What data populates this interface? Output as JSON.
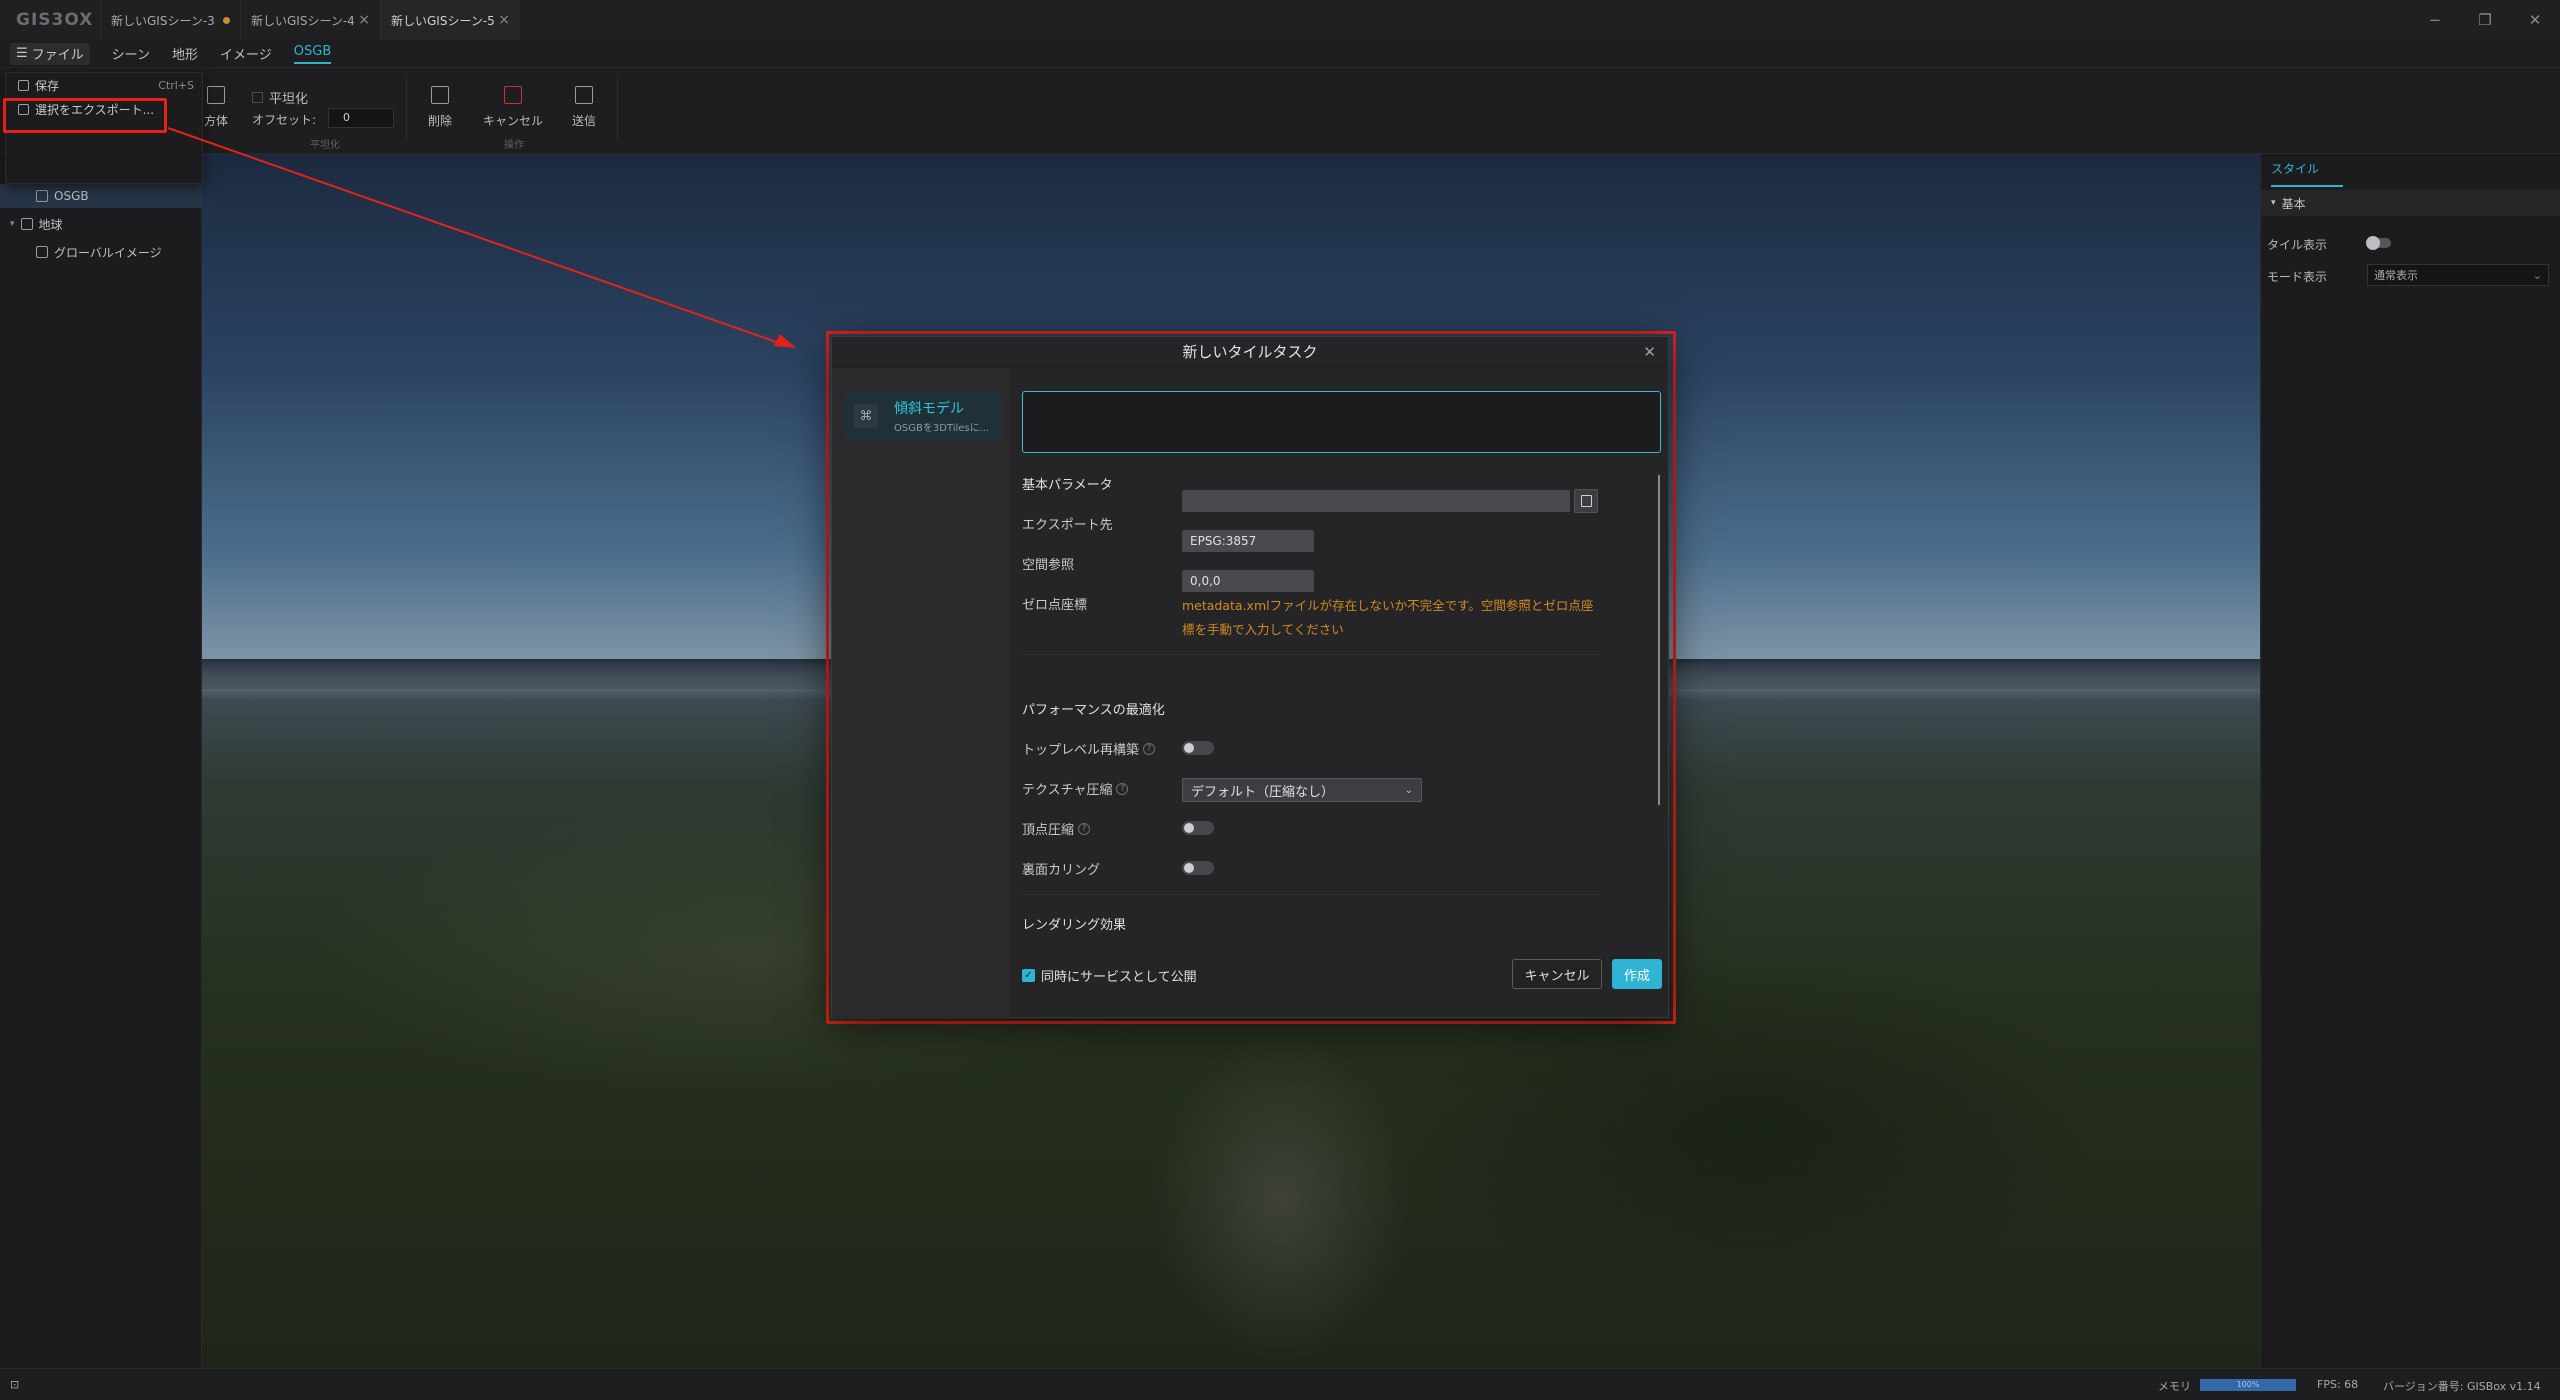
{
  "app": {
    "logo": "GIS3OX"
  },
  "tabs": [
    {
      "label": "新しいGISシーン-3",
      "marker": "dot"
    },
    {
      "label": "新しいGISシーン-4",
      "marker": "close"
    },
    {
      "label": "新しいGISシーン-5",
      "marker": "close"
    }
  ],
  "window_controls": {
    "minimize": "−",
    "restore": "❐",
    "close": "✕"
  },
  "menubar": {
    "file": "ファイル",
    "items": [
      "シーン",
      "地形",
      "イメージ",
      "OSGB"
    ],
    "active": "OSGB"
  },
  "file_menu": {
    "save": "保存",
    "save_shortcut": "Ctrl+S",
    "export": "選択をエクスポート..."
  },
  "ribbon": {
    "cube_label": "方体",
    "flatten_label": "平坦化",
    "offset_label": "オフセット:",
    "offset_value": "0",
    "group_flatten": "平坦化",
    "delete_label": "削除",
    "cancel_label": "キャンセル",
    "send_label": "送信",
    "group_ops": "操作"
  },
  "layer_tree": {
    "items": [
      {
        "label": "OSGB",
        "selected": true
      },
      {
        "label": "地球",
        "selected": false
      },
      {
        "label": "グローバルイメージ",
        "selected": false
      }
    ]
  },
  "right_panel": {
    "tab": "スタイル",
    "section": "基本",
    "tile_display_label": "タイル表示",
    "mode_label": "モード表示",
    "mode_value": "通常表示"
  },
  "status": {
    "memory_label": "メモリ",
    "memory_percent": 100,
    "memory_text": "100%",
    "fps": "FPS: 68",
    "version": "バージョン番号: GISBox v1.14"
  },
  "dialog": {
    "title": "新しいタイルタスク",
    "type_card": {
      "title": "傾斜モデル",
      "subtitle": "OSGBを3DTilesに..."
    },
    "name_value": "",
    "basic_section": "基本パラメータ",
    "export_to_label": "エクスポート先",
    "export_to_value": "",
    "spatial_ref_label": "空間参照",
    "spatial_ref_value": "EPSG:3857",
    "zero_point_label": "ゼロ点座標",
    "zero_point_value": "0,0,0",
    "warning": "metadata.xmlファイルが存在しないか不完全です。空間参照とゼロ点座標を手動で入力してください",
    "perf_section": "パフォーマンスの最適化",
    "top_level_rebuild_label": "トップレベル再構築",
    "texture_compress_label": "テクスチャ圧縮",
    "texture_compress_value": "デフォルト（圧縮なし）",
    "vertex_compress_label": "頂点圧縮",
    "backface_culling_label": "裏面カリング",
    "render_section": "レンダリング効果",
    "publish_checkbox_label": "同時にサービスとして公開",
    "publish_checked": true,
    "cancel_button": "キャンセル",
    "create_button": "作成"
  },
  "colors": {
    "accent": "#2fb5d3",
    "warning": "#d18a1f",
    "highlight": "#e4221b"
  }
}
